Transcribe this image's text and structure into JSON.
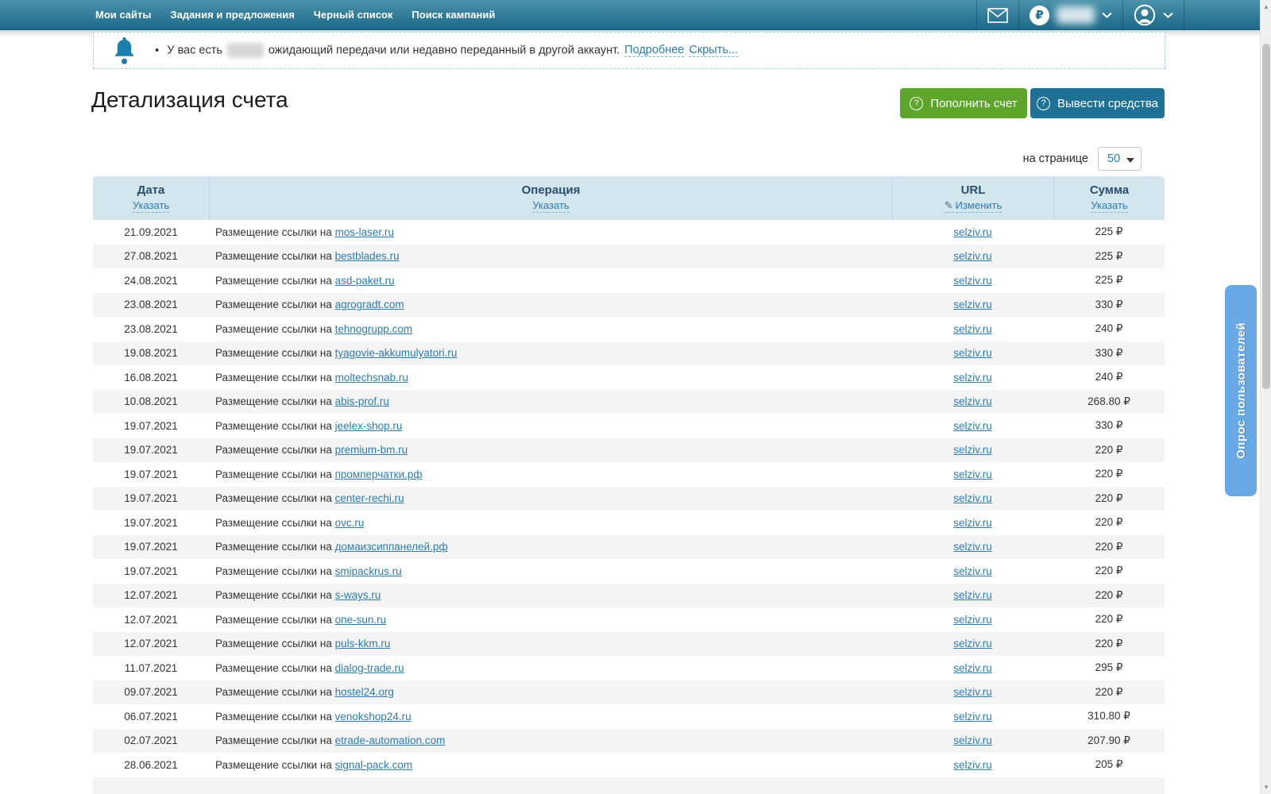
{
  "topnav": {
    "items": [
      {
        "label": "Мои сайты"
      },
      {
        "label": "Задания и предложения"
      },
      {
        "label": "Черный список"
      },
      {
        "label": "Поиск кампаний"
      }
    ]
  },
  "notification": {
    "prefix": "У вас есть",
    "suffix": "ожидающий передачи или недавно переданный в другой аккаунт.",
    "details_link": "Подробнее",
    "hide_link": "Скрыть..."
  },
  "page": {
    "title": "Детализация счета",
    "topup_button": "Пополнить счет",
    "withdraw_button": "Вывести средства",
    "per_page_label": "на странице",
    "per_page_value": "50"
  },
  "survey_tab_label": "Опрос пользователей",
  "table": {
    "columns": {
      "date": {
        "title": "Дата",
        "action": "Указать"
      },
      "operation": {
        "title": "Операция",
        "action": "Указать"
      },
      "url": {
        "title": "URL",
        "action": "Изменить"
      },
      "amount": {
        "title": "Сумма",
        "action": "Указать"
      }
    },
    "operation_prefix": "Размещение ссылки на",
    "rows": [
      {
        "date": "21.09.2021",
        "site": "mos-laser.ru",
        "url": "selziv.ru",
        "amount": "225 ₽"
      },
      {
        "date": "27.08.2021",
        "site": "bestblades.ru",
        "url": "selziv.ru",
        "amount": "225 ₽"
      },
      {
        "date": "24.08.2021",
        "site": "asd-paket.ru",
        "url": "selziv.ru",
        "amount": "225 ₽"
      },
      {
        "date": "23.08.2021",
        "site": "agrogradt.com",
        "url": "selziv.ru",
        "amount": "330 ₽"
      },
      {
        "date": "23.08.2021",
        "site": "tehnogrupp.com",
        "url": "selziv.ru",
        "amount": "240 ₽"
      },
      {
        "date": "19.08.2021",
        "site": "tyagovie-akkumulyatori.ru",
        "url": "selziv.ru",
        "amount": "330 ₽"
      },
      {
        "date": "16.08.2021",
        "site": "moltechsnab.ru",
        "url": "selziv.ru",
        "amount": "240 ₽"
      },
      {
        "date": "10.08.2021",
        "site": "abis-prof.ru",
        "url": "selziv.ru",
        "amount": "268.80 ₽"
      },
      {
        "date": "19.07.2021",
        "site": "jeelex-shop.ru",
        "url": "selziv.ru",
        "amount": "330 ₽"
      },
      {
        "date": "19.07.2021",
        "site": "premium-bm.ru",
        "url": "selziv.ru",
        "amount": "220 ₽"
      },
      {
        "date": "19.07.2021",
        "site": "промперчатки.рф",
        "url": "selziv.ru",
        "amount": "220 ₽"
      },
      {
        "date": "19.07.2021",
        "site": "center-rechi.ru",
        "url": "selziv.ru",
        "amount": "220 ₽"
      },
      {
        "date": "19.07.2021",
        "site": "ovc.ru",
        "url": "selziv.ru",
        "amount": "220 ₽"
      },
      {
        "date": "19.07.2021",
        "site": "домаизсиппанелей.рф",
        "url": "selziv.ru",
        "amount": "220 ₽"
      },
      {
        "date": "19.07.2021",
        "site": "smipackrus.ru",
        "url": "selziv.ru",
        "amount": "220 ₽"
      },
      {
        "date": "12.07.2021",
        "site": "s-ways.ru",
        "url": "selziv.ru",
        "amount": "220 ₽"
      },
      {
        "date": "12.07.2021",
        "site": "one-sun.ru",
        "url": "selziv.ru",
        "amount": "220 ₽"
      },
      {
        "date": "12.07.2021",
        "site": "puls-kkm.ru",
        "url": "selziv.ru",
        "amount": "220 ₽"
      },
      {
        "date": "11.07.2021",
        "site": "dialog-trade.ru",
        "url": "selziv.ru",
        "amount": "295 ₽"
      },
      {
        "date": "09.07.2021",
        "site": "hostel24.org",
        "url": "selziv.ru",
        "amount": "220 ₽"
      },
      {
        "date": "06.07.2021",
        "site": "venokshop24.ru",
        "url": "selziv.ru",
        "amount": "310.80 ₽"
      },
      {
        "date": "02.07.2021",
        "site": "etrade-automation.com",
        "url": "selziv.ru",
        "amount": "207.90 ₽"
      },
      {
        "date": "28.06.2021",
        "site": "signal-pack.com",
        "url": "selziv.ru",
        "amount": "205 ₽"
      }
    ]
  },
  "icons": {
    "envelope": "mail-icon",
    "ruble": "₽",
    "user": "user-icon",
    "bell": "bell-icon",
    "question": "?",
    "pencil": "✎"
  },
  "colors": {
    "topnav_gradient_top": "#4b92aa",
    "topnav_gradient_bottom": "#1b6989",
    "button_green": "#5ea62b",
    "button_blue": "#1f7196",
    "link_blue": "#2b7cb0",
    "table_header_bg": "#d3e5ed",
    "row_alt_bg": "#f4f4f4",
    "survey_tab_bg": "#68a9e8"
  }
}
